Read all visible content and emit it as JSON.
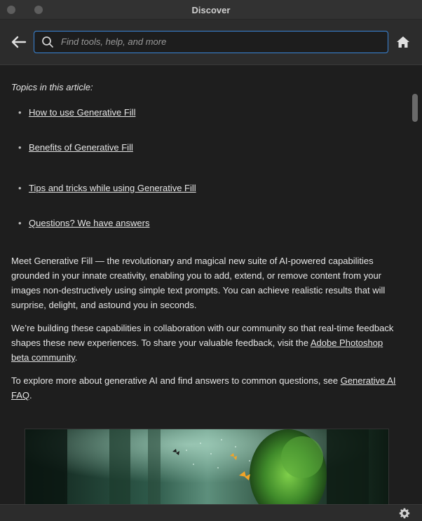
{
  "window": {
    "title": "Discover"
  },
  "search": {
    "placeholder": "Find tools, help, and more",
    "value": ""
  },
  "article": {
    "topics_heading": "Topics in this article:",
    "topics": [
      "How to use Generative Fill",
      "Benefits of Generative Fill",
      "Tips and tricks while using Generative Fill",
      "Questions? We have answers"
    ],
    "p1": "Meet Generative Fill — the revolutionary and magical new suite of AI-powered capabilities grounded in your innate creativity, enabling you to add, extend, or remove content from your images non-destructively using simple text prompts. You can achieve realistic results that will surprise, delight, and astound you in seconds.",
    "p2_text": "We’re building these capabilities in collaboration with our community so that real-time feedback shapes these new experiences. To share your valuable feedback, visit the ",
    "p2_link": "Adobe Photoshop beta community",
    "p2_end": ".",
    "p3_text": "To explore more about generative AI and find answers to common questions, see ",
    "p3_link": "Generative AI FAQ",
    "p3_end": "."
  },
  "icons": {
    "back": "arrow-left-icon",
    "search": "search-icon",
    "home": "home-icon",
    "settings": "gear-icon"
  },
  "colors": {
    "accent": "#3a86d8",
    "background": "#1e1e1e",
    "header": "#2c2c2c"
  }
}
